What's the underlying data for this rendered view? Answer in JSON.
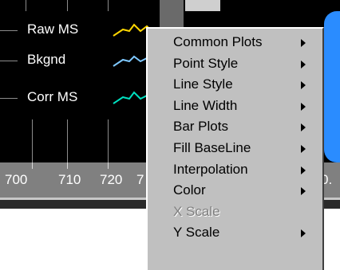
{
  "legend": [
    {
      "label": "Raw MS",
      "color": "#ffd700",
      "icon": "yellow-line-swatch-icon"
    },
    {
      "label": "Bkgnd",
      "color": "#7ec8ff",
      "icon": "blue-line-swatch-icon"
    },
    {
      "label": "Corr MS",
      "color": "#00e0c0",
      "icon": "cyan-line-swatch-icon"
    }
  ],
  "x_axis": {
    "tick_labels": [
      "700",
      "710",
      "720"
    ],
    "clipped_left_label": "7",
    "clipped_right_label": "0."
  },
  "menu": {
    "items": [
      {
        "label": "Common Plots",
        "submenu": true,
        "enabled": true
      },
      {
        "label": "Point Style",
        "submenu": true,
        "enabled": true
      },
      {
        "label": "Line Style",
        "submenu": true,
        "enabled": true
      },
      {
        "label": "Line Width",
        "submenu": true,
        "enabled": true
      },
      {
        "label": "Bar Plots",
        "submenu": true,
        "enabled": true
      },
      {
        "label": "Fill BaseLine",
        "submenu": true,
        "enabled": true
      },
      {
        "label": "Interpolation",
        "submenu": true,
        "enabled": true
      },
      {
        "label": "Color",
        "submenu": true,
        "enabled": true
      },
      {
        "label": "X Scale",
        "submenu": false,
        "enabled": false
      },
      {
        "label": "Y Scale",
        "submenu": true,
        "enabled": true
      }
    ]
  },
  "colors": {
    "plot_background": "#000000",
    "menu_background": "#c0c0c0",
    "disabled_text": "#808080",
    "axis_strip": "#808080",
    "accent_blue": "#2a8cff"
  }
}
